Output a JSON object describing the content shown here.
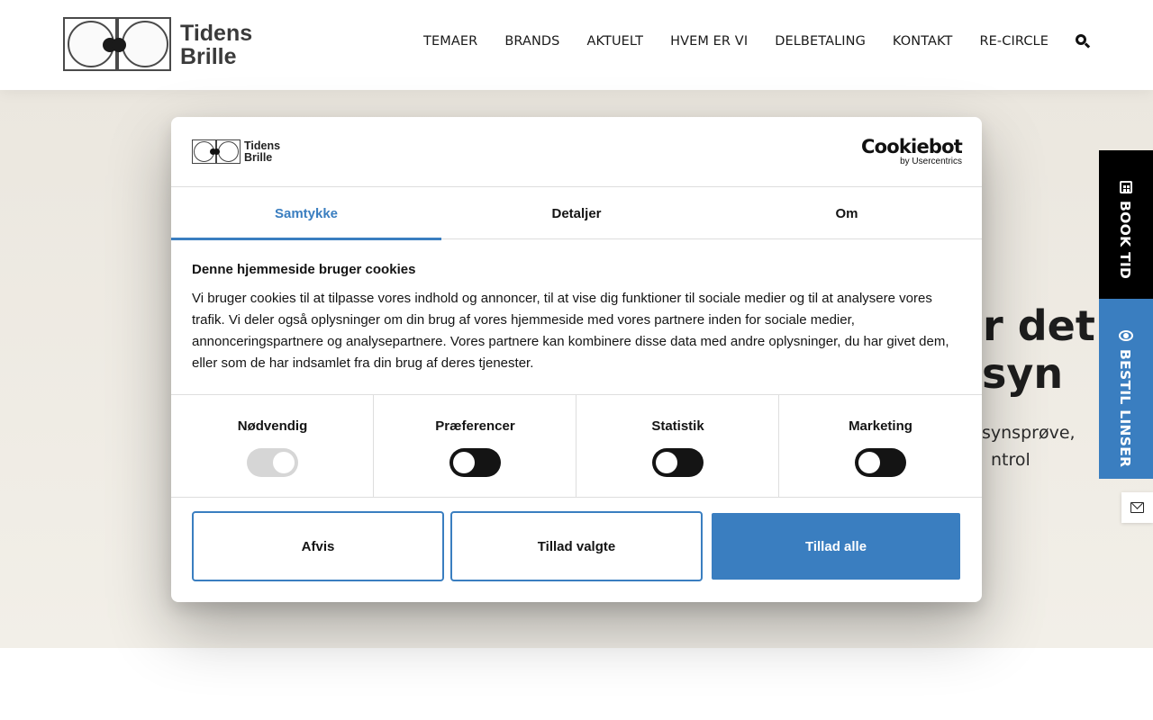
{
  "header": {
    "logo": {
      "line1": "Tidens",
      "line2": "Brille"
    },
    "nav": [
      "TEMAER",
      "BRANDS",
      "AKTUELT",
      "HVEM ER VI",
      "DELBETALING",
      "KONTAKT",
      "RE-CIRCLE"
    ]
  },
  "hero": {
    "title_line1": "ar det",
    "title_line2": "syn",
    "sub_line1": "synsprøve,",
    "sub_line2": "ntrol"
  },
  "side": {
    "book": "BOOK TID",
    "lenses": "BESTIL LINSER"
  },
  "dialog": {
    "brand": {
      "line1": "Tidens",
      "line2": "Brille"
    },
    "cookiebot": {
      "name": "Cookiebot",
      "by": "by Usercentrics"
    },
    "tabs": [
      "Samtykke",
      "Detaljer",
      "Om"
    ],
    "heading": "Denne hjemmeside bruger cookies",
    "text": "Vi bruger cookies til at tilpasse vores indhold og annoncer, til at vise dig funktioner til sociale medier og til at analysere vores trafik. Vi deler også oplysninger om din brug af vores hjemmeside med vores partnere inden for sociale medier, annonceringspartnere og analysepartnere. Vores partnere kan kombinere disse data med andre oplysninger, du har givet dem, eller som de har indsamlet fra din brug af deres tjenester.",
    "categories": [
      {
        "label": "Nødvendig",
        "state": "on-disabled"
      },
      {
        "label": "Præferencer",
        "state": "off"
      },
      {
        "label": "Statistik",
        "state": "off"
      },
      {
        "label": "Marketing",
        "state": "off"
      }
    ],
    "buttons": {
      "deny": "Afvis",
      "allow_selected": "Tillad valgte",
      "allow_all": "Tillad alle"
    }
  },
  "colors": {
    "accent": "#3a7ec0",
    "text": "#141414",
    "hero_bg": "#ebe7df"
  },
  "icons": {
    "search": "search-icon",
    "calendar": "calendar-icon",
    "eye": "eye-icon",
    "mail": "mail-icon"
  }
}
